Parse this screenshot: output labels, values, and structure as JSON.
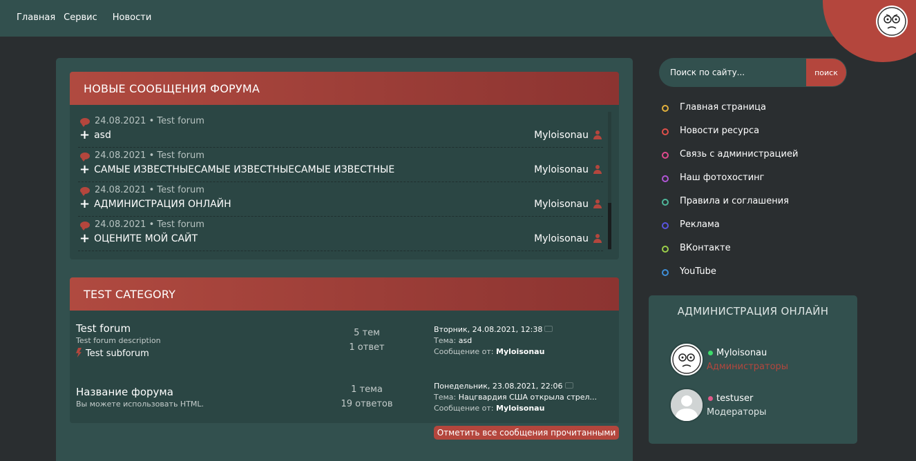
{
  "nav": {
    "items": [
      "Главная",
      "Сервис",
      "Новости"
    ]
  },
  "news_block": {
    "title": "НОВЫЕ СООБЩЕНИЯ ФОРУМА",
    "messages": [
      {
        "date": "24.08.2021",
        "sep": "•",
        "forum": "Test forum",
        "topic": "asd",
        "author": "Myloisonau"
      },
      {
        "date": "24.08.2021",
        "sep": "•",
        "forum": "Test forum",
        "topic": "САМЫЕ ИЗВЕСТНЫЕСАМЫЕ ИЗВЕСТНЫЕСАМЫЕ ИЗВЕСТНЫЕ",
        "author": "Myloisonau"
      },
      {
        "date": "24.08.2021",
        "sep": "•",
        "forum": "Test forum",
        "topic": "АДМИНИСТРАЦИЯ ОНЛАЙН",
        "author": "Myloisonau"
      },
      {
        "date": "24.08.2021",
        "sep": "•",
        "forum": "Test forum",
        "topic": "ОЦЕНИТЕ МОЙ САЙТ",
        "author": "Myloisonau"
      }
    ]
  },
  "category": {
    "title": "TEST CATEGORY",
    "forums": [
      {
        "name": "Test forum",
        "description": "Test forum description",
        "subforum": "Test subforum",
        "topics": "5 тем",
        "replies": "1 ответ",
        "last_date": "Вторник, 24.08.2021, 12:38",
        "topic_label": "Тема:",
        "topic_value": "asd",
        "message_label": "Сообщение от:",
        "message_author": "Myloisonau"
      },
      {
        "name": "Название форума",
        "description": "Вы можете использовать HTML.",
        "topics": "1 тема",
        "replies": "19 ответов",
        "last_date": "Понедельник, 23.08.2021, 22:06",
        "topic_label": "Тема:",
        "topic_value": "Нацгвардия США открыла стрел...",
        "message_label": "Сообщение от:",
        "message_author": "Myloisonau"
      }
    ],
    "mark_read_label": "Отметить все сообщения прочитанными"
  },
  "search": {
    "placeholder": "Поиск по сайту...",
    "button_label": "поиск"
  },
  "sidebar_links": [
    {
      "label": "Главная страница",
      "color": "#e2b13c"
    },
    {
      "label": "Новости ресурса",
      "color": "#e0504a"
    },
    {
      "label": "Связь с администрацией",
      "color": "#e14a8e"
    },
    {
      "label": "Наш фотохостинг",
      "color": "#b156d6"
    },
    {
      "label": "Правила и соглашения",
      "color": "#4fb79a"
    },
    {
      "label": "Реклама",
      "color": "#5a55e0"
    },
    {
      "label": "ВКонтакте",
      "color": "#9ccf4a"
    },
    {
      "label": "YouTube",
      "color": "#3f8fd8"
    }
  ],
  "online": {
    "title": "АДМИНИСТРАЦИЯ ОНЛАЙН",
    "users": [
      {
        "name": "Myloisonau",
        "role": "Администраторы",
        "status_color": "#3ddc6a",
        "role_color": "#b4463d"
      },
      {
        "name": "testuser",
        "role": "Модераторы",
        "status_color": "#e05a8a",
        "role_color": "#dfe6e5"
      }
    ]
  },
  "colors": {
    "accent": "#b4463d",
    "panel": "#32504e",
    "background": "#2a2e30"
  }
}
